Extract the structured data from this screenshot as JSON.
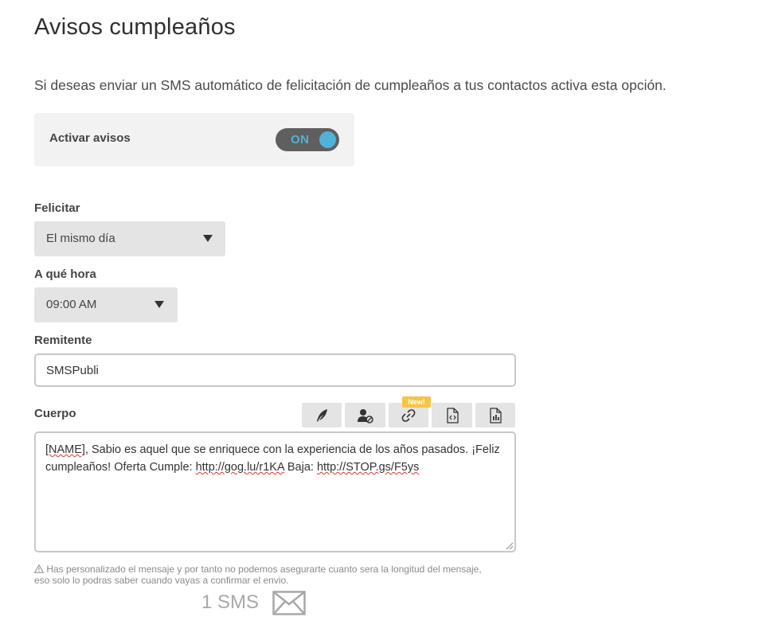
{
  "page": {
    "title": "Avisos cumpleaños",
    "description": "Si deseas enviar un SMS automático de felicitación de cumpleaños a tus contactos activa esta opción."
  },
  "activation": {
    "label": "Activar avisos",
    "toggle_text": "ON",
    "enabled": true
  },
  "felicitar": {
    "label": "Felicitar",
    "selected": "El mismo día"
  },
  "hora": {
    "label": "A qué hora",
    "selected": "09:00 AM"
  },
  "remitente": {
    "label": "Remitente",
    "value": "SMSPubli"
  },
  "cuerpo": {
    "label": "Cuerpo",
    "toolbar": {
      "new_badge": "New!",
      "buttons": [
        "feather-icon",
        "user-block-icon",
        "link-icon",
        "code-file-icon",
        "chart-file-icon"
      ]
    },
    "text_parts": {
      "p1": "[NAME]",
      "p2": ", Sabio es aquel que se enriquece con la experiencia de los años pasados. ¡Feliz cumpleaños! Oferta Cumple: ",
      "p3": "http://gog.lu/r1KA",
      "p4": " Baja: ",
      "p5": "http://STOP.gs/F5ys"
    }
  },
  "warning": {
    "icon": "warning-icon",
    "text": "Has personalizado el mensaje y por tanto no podemos asegurarte cuanto sera la longitud del mensaje, eso solo lo podras saber cuando vayas a confirmar el envio."
  },
  "sms": {
    "count_label": "1 SMS",
    "icon": "envelope-icon"
  },
  "colors": {
    "accent": "#4fb3d9",
    "toggle_bg": "#5f5f5f",
    "badge": "#f6c544"
  }
}
